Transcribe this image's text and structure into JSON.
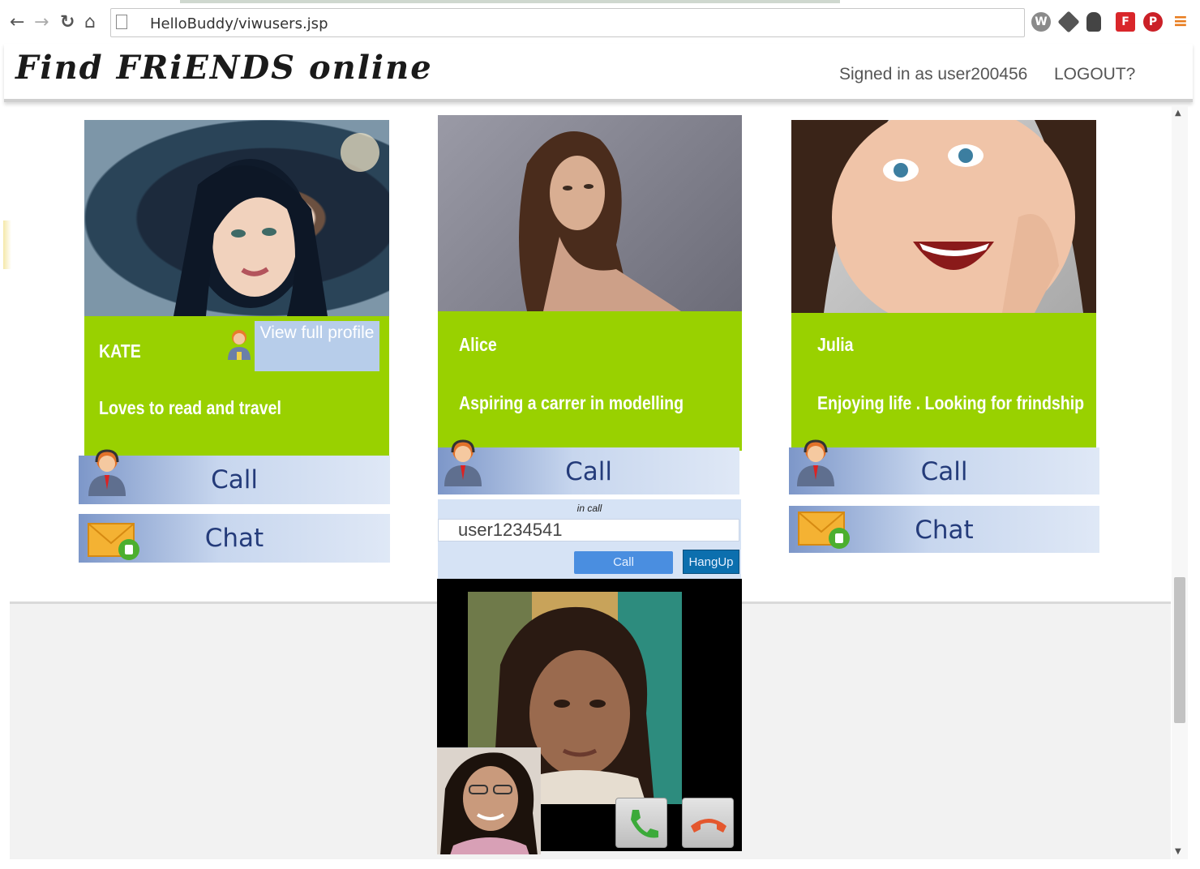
{
  "browser": {
    "url": "HelloBuddy/viwusers.jsp"
  },
  "header": {
    "logo": "Find FRiENDS online",
    "signed_in": "Signed in as user200456",
    "logout": "LOGOUT?"
  },
  "profiles": [
    {
      "name": "KATE",
      "tagline": "Loves to read  and travel",
      "view_profile_label": "View full profile",
      "call_label": "Call",
      "chat_label": "Chat"
    },
    {
      "name": "Alice",
      "tagline": "Aspiring a carrer in modelling",
      "call_label": "Call"
    },
    {
      "name": "Julia",
      "tagline": "Enjoying life . Looking for frindship",
      "call_label": "Call",
      "chat_label": "Chat"
    }
  ],
  "call_widget": {
    "status": "in call",
    "user_value": "user1234541",
    "call_button": "Call",
    "hangup_button": "HangUp"
  },
  "icons": {
    "back": "back-arrow-icon",
    "forward": "forward-arrow-icon",
    "reload": "reload-icon",
    "home": "home-icon",
    "agent": "call-agent-icon",
    "mail": "mail-icon",
    "phone": "phone-icon",
    "hangup": "hangup-icon"
  },
  "colors": {
    "card_green": "#99d100",
    "button_blue": "#7d97c9",
    "button_text": "#243b7a"
  }
}
